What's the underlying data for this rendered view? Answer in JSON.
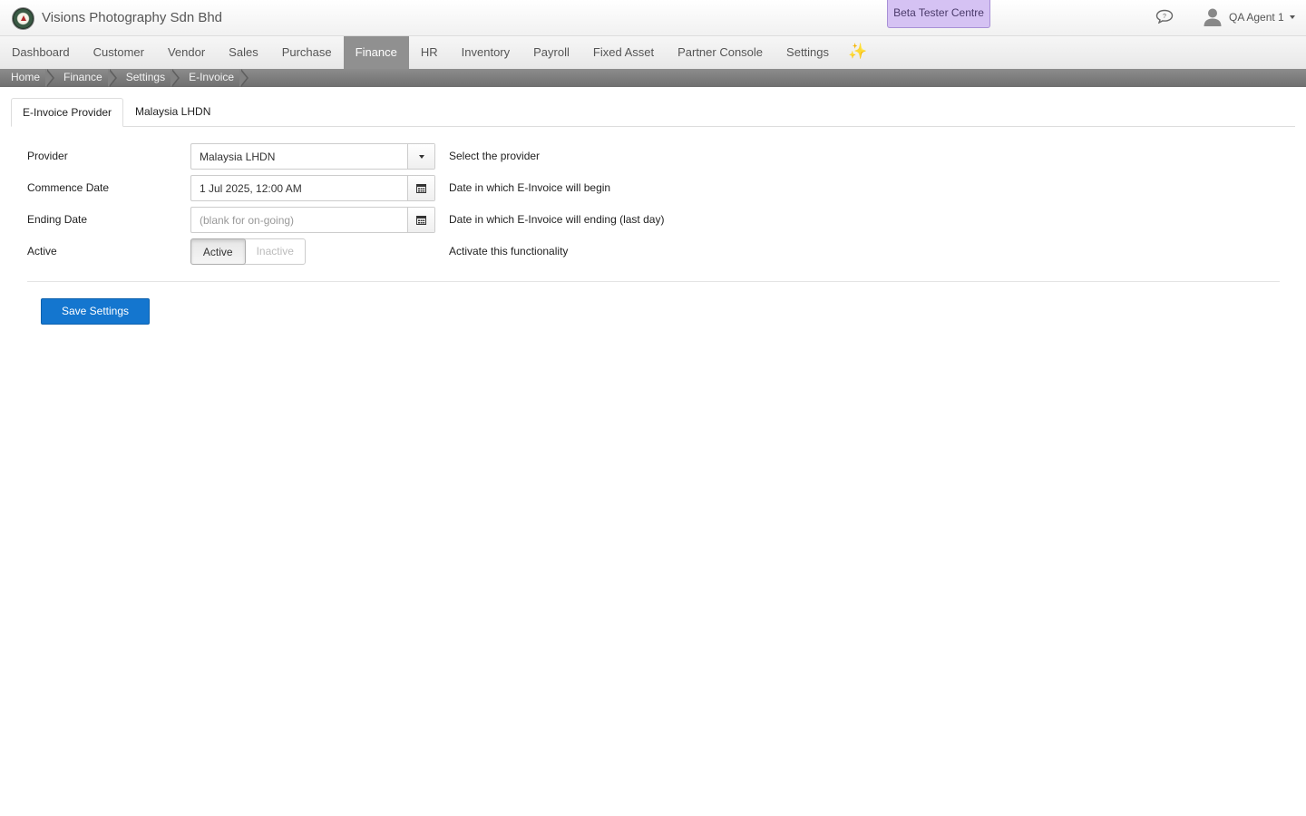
{
  "header": {
    "company": "Visions Photography Sdn Bhd",
    "beta_label": "Beta Tester Centre",
    "user_name": "QA Agent 1"
  },
  "nav": {
    "items": [
      "Dashboard",
      "Customer",
      "Vendor",
      "Sales",
      "Purchase",
      "Finance",
      "HR",
      "Inventory",
      "Payroll",
      "Fixed Asset",
      "Partner Console",
      "Settings"
    ],
    "active": "Finance",
    "sparkle": "✨"
  },
  "breadcrumb": [
    "Home",
    "Finance",
    "Settings",
    "E-Invoice"
  ],
  "tabs": [
    "E-Invoice Provider",
    "Malaysia LHDN"
  ],
  "form": {
    "provider": {
      "label": "Provider",
      "value": "Malaysia LHDN",
      "help": "Select the provider"
    },
    "commence": {
      "label": "Commence Date",
      "value": "1 Jul 2025, 12:00 AM",
      "help": "Date in which E-Invoice will begin"
    },
    "ending": {
      "label": "Ending Date",
      "placeholder": "(blank for on-going)",
      "help": "Date in which E-Invoice will ending (last day)"
    },
    "active": {
      "label": "Active",
      "on_label": "Active",
      "off_label": "Inactive",
      "help": "Activate this functionality"
    }
  },
  "save_label": "Save Settings",
  "colors": {
    "primary": "#1476cf",
    "nav_active": "#909090",
    "beta": "#d5c2f3"
  }
}
